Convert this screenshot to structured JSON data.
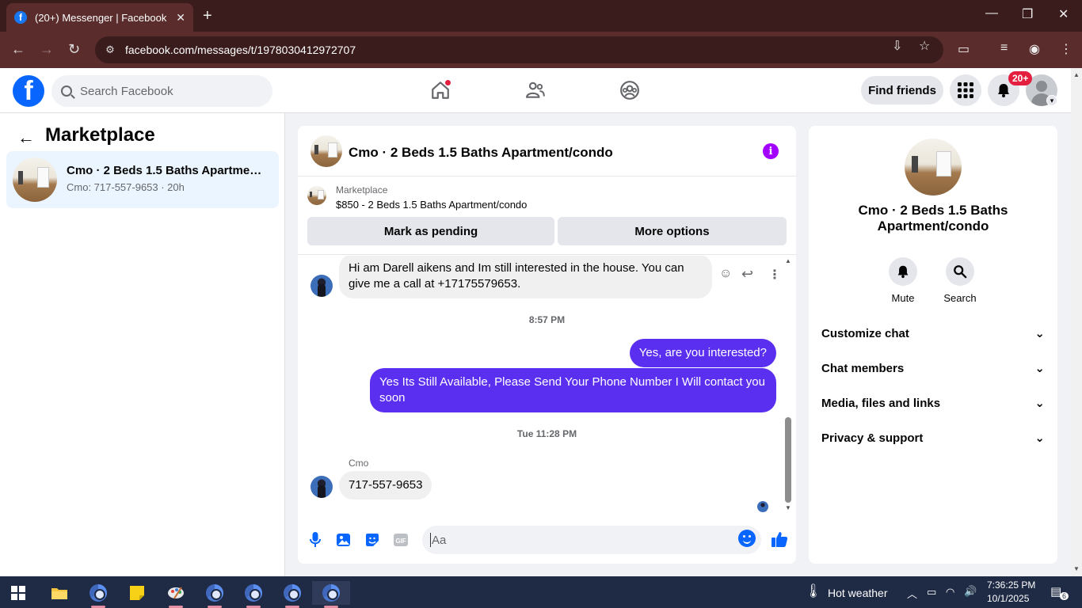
{
  "browser": {
    "tab_title": "(20+) Messenger | Facebook",
    "url": "facebook.com/messages/t/1978030412972707"
  },
  "fb": {
    "logo": "f",
    "search_placeholder": "Search Facebook",
    "find_friends": "Find friends",
    "notif_badge": "20+"
  },
  "sidebar": {
    "title": "Marketplace",
    "conversations": [
      {
        "name": "Cmo · 2 Beds 1.5 Baths Apartment/condo",
        "sub": "Cmo: 717-557-9653 · 20h"
      }
    ]
  },
  "chat": {
    "title": "Cmo · 2 Beds 1.5 Baths Apartment/condo",
    "listing_label": "Marketplace",
    "listing_price": "$850 - 2 Beds 1.5 Baths Apartment/condo",
    "mark_pending": "Mark as pending",
    "more_options": "More options",
    "messages": [
      {
        "from": "them",
        "text": "Hi am Darell aikens and Im still interested in the house. You can give me a call at +17175579653."
      },
      {
        "timestamp": "8:57 PM"
      },
      {
        "from": "me",
        "text": "Yes, are you interested?"
      },
      {
        "from": "me",
        "text": "Yes Its Still Available, Please Send Your Phone Number I Will contact you soon"
      },
      {
        "timestamp": "Tue 11:28 PM"
      },
      {
        "from": "them",
        "sender": "Cmo",
        "text": "717-557-9653"
      }
    ],
    "input_placeholder": "Aa"
  },
  "details": {
    "title": "Cmo · 2 Beds 1.5 Baths Apartment/condo",
    "mute": "Mute",
    "search": "Search",
    "sections": [
      "Customize chat",
      "Chat members",
      "Media, files and links",
      "Privacy & support"
    ]
  },
  "taskbar": {
    "weather": "Hot weather",
    "time": "7:36:25 PM",
    "date": "10/1/2025",
    "notifications": "6"
  },
  "colors": {
    "fb_blue": "#0866ff",
    "outgoing_bubble": "#5b2ff0",
    "browser_frame": "#5a2c2c",
    "selected_row": "#ebf5ff",
    "badge_red": "#e41e3f"
  }
}
